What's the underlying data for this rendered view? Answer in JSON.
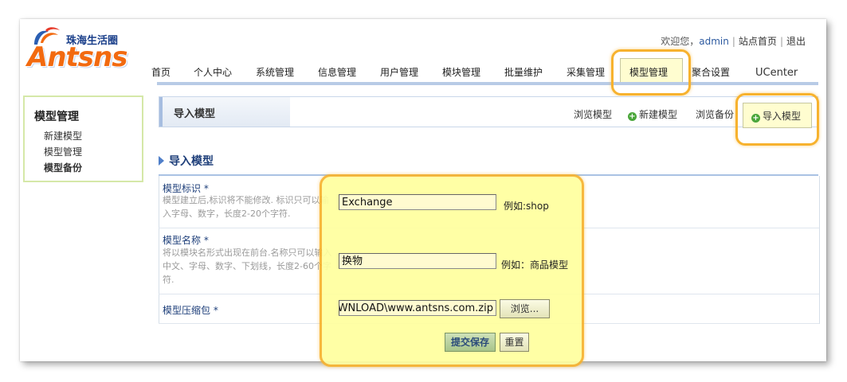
{
  "brand": {
    "cn": "珠海生活圈",
    "en": "Antsns"
  },
  "toplinks": {
    "welcome": "欢迎您，",
    "user": "admin",
    "home": "站点首页",
    "logout": "退出"
  },
  "nav": [
    "首页",
    "个人中心",
    "系统管理",
    "信息管理",
    "用户管理",
    "模块管理",
    "批量维护",
    "采集管理",
    "模型管理",
    "聚合设置",
    "UCenter"
  ],
  "sidebar": {
    "title": "模型管理",
    "items": [
      "新建模型",
      "模型管理",
      "模型备份"
    ]
  },
  "header": {
    "title": "导入模型"
  },
  "tabs": {
    "browse": "浏览模型",
    "new": "新建模型",
    "backup": "浏览备份",
    "import": "导入模型"
  },
  "section": {
    "title": "导入模型"
  },
  "form": {
    "id": {
      "label": "模型标识 *",
      "help": "模型建立后,标识将不能修改. 标识只可以输入字母、数字，长度2-20个字符.",
      "value": "Exchange",
      "example": "例如:shop"
    },
    "name": {
      "label": "模型名称 *",
      "help": "将以模块名形式出现在前台.名称只可以输入中文、字母、数字、下划线，长度2-60个字符.",
      "value": "换物",
      "example": "例如：商品模型"
    },
    "file": {
      "label": "模型压缩包 *",
      "value": "WNLOAD\\www.antsns.com.zip",
      "browse": "浏览..."
    },
    "submit": "提交保存",
    "reset": "重置"
  },
  "colors": {
    "accent": "#f7b22e",
    "highlight": "#ffff9e",
    "brand_orange": "#f26a10",
    "brand_blue": "#1a3f8a"
  }
}
